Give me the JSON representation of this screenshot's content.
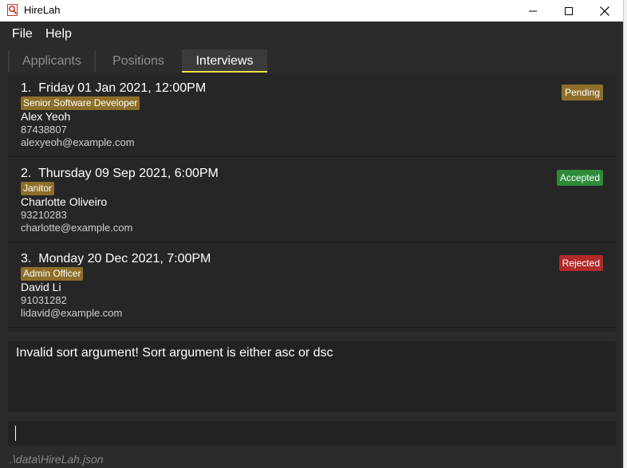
{
  "window": {
    "title": "HireLah",
    "controls": [
      "minimize",
      "maximize",
      "close"
    ]
  },
  "menu": {
    "file_label": "File",
    "help_label": "Help"
  },
  "tabs": [
    {
      "label": "Applicants",
      "active": false
    },
    {
      "label": "Positions",
      "active": false
    },
    {
      "label": "Interviews",
      "active": true
    }
  ],
  "interviews": [
    {
      "title": "1.  Friday 01 Jan 2021, 12:00PM",
      "position": "Senior Software Developer",
      "name": "Alex Yeoh",
      "phone": "87438807",
      "email": "alexyeoh@example.com",
      "status": "Pending",
      "status_color": "#8e6f2a"
    },
    {
      "title": "2.  Thursday 09 Sep 2021, 6:00PM",
      "position": "Janitor",
      "name": "Charlotte Oliveiro",
      "phone": "93210283",
      "email": "charlotte@example.com",
      "status": "Accepted",
      "status_color": "#2e8b3a"
    },
    {
      "title": "3.  Monday 20 Dec 2021, 7:00PM",
      "position": "Admin Officer",
      "name": "David Li",
      "phone": "91031282",
      "email": "lidavid@example.com",
      "status": "Rejected",
      "status_color": "#b02a2a"
    }
  ],
  "result": {
    "message": "Invalid sort argument! Sort argument is either asc or dsc"
  },
  "command": {
    "value": ""
  },
  "status_bar": {
    "save_path": ".\\data\\HireLah.json"
  },
  "colors": {
    "background": "#2b2b2b",
    "tab_active_underline": "#e6e34a",
    "tag": "#8e6f2a"
  }
}
